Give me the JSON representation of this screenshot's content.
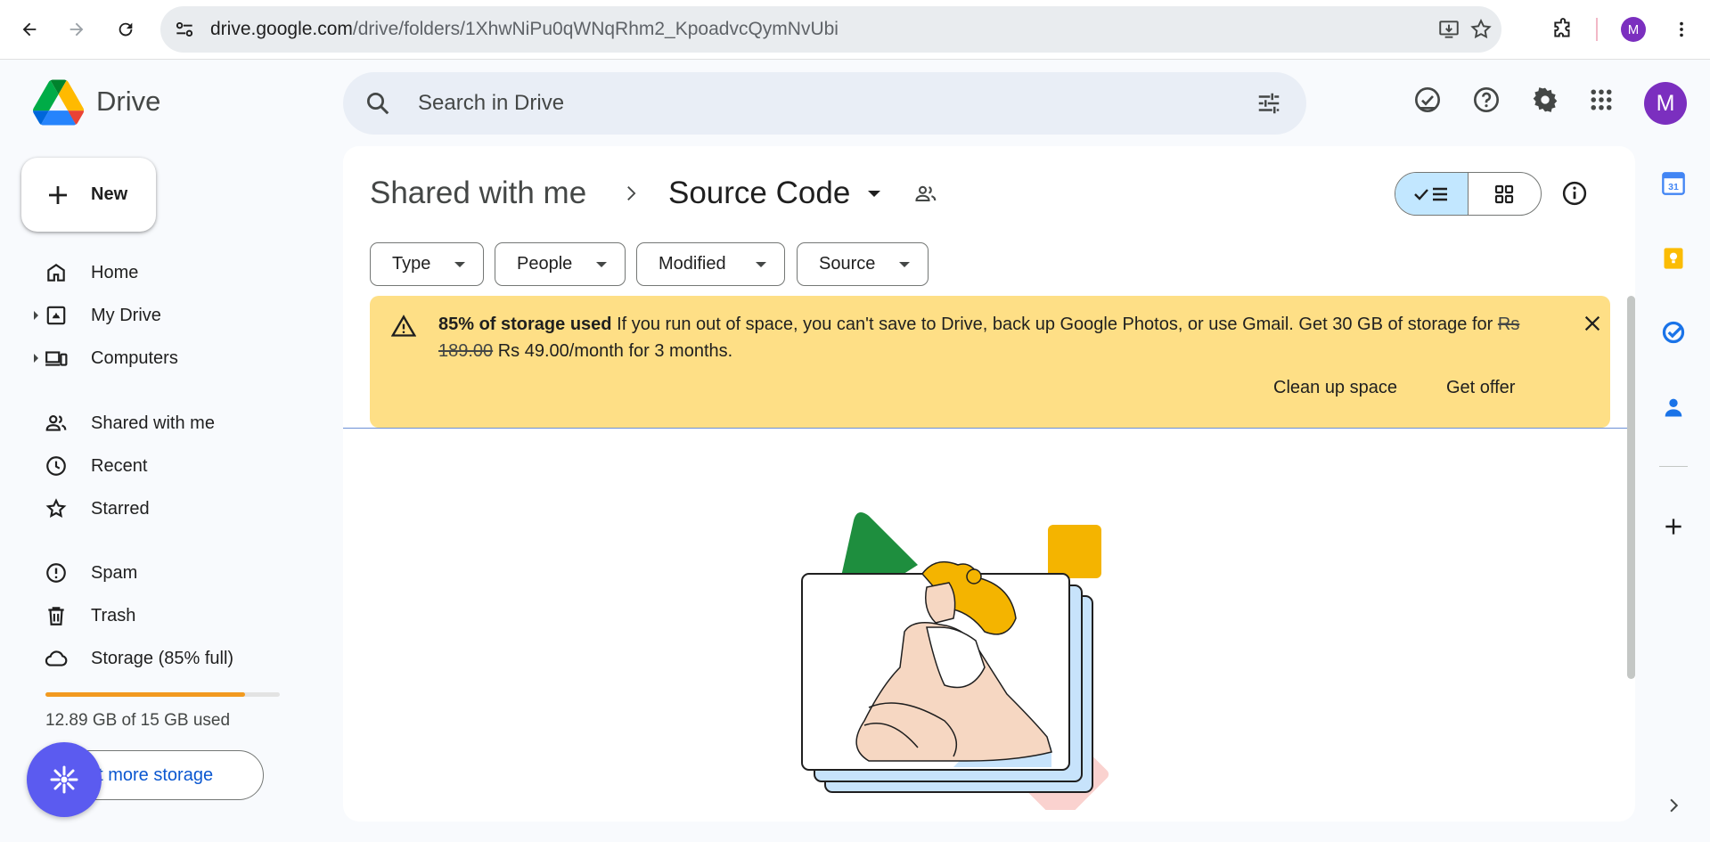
{
  "browser": {
    "url_host": "drive.google.com",
    "url_path": "/drive/folders/1XhwNiPu0qWNqRhm2_KpoadvcQymNvUbi",
    "profile_initial": "M"
  },
  "header": {
    "brand": "Drive",
    "search_placeholder": "Search in Drive",
    "avatar_initial": "M"
  },
  "sidebar": {
    "new_label": "New",
    "items": [
      {
        "label": "Home",
        "icon": "home-icon"
      },
      {
        "label": "My Drive",
        "icon": "my-drive-icon"
      },
      {
        "label": "Computers",
        "icon": "computers-icon"
      },
      {
        "label": "Shared with me",
        "icon": "shared-icon"
      },
      {
        "label": "Recent",
        "icon": "clock-icon"
      },
      {
        "label": "Starred",
        "icon": "star-icon"
      },
      {
        "label": "Spam",
        "icon": "spam-icon"
      },
      {
        "label": "Trash",
        "icon": "trash-icon"
      },
      {
        "label": "Storage (85% full)",
        "icon": "cloud-icon"
      }
    ],
    "storage_fraction": 0.85,
    "storage_text": "12.89 GB of 15 GB used",
    "get_storage_label": "et more storage"
  },
  "main": {
    "breadcrumb_root": "Shared with me",
    "breadcrumb_current": "Source Code",
    "filters": [
      "Type",
      "People",
      "Modified",
      "Source"
    ],
    "banner": {
      "title": "85% of storage used",
      "text": "If you run out of space, you can't save to Drive, back up Google Photos, or use Gmail. Get 30 GB of storage for",
      "old_price": "Rs 189.00",
      "new_price": "Rs 49.00/month for 3 months.",
      "action_cleanup": "Clean up space",
      "action_offer": "Get offer"
    }
  },
  "colors": {
    "accent": "#0b57d0",
    "banner_bg": "#fedf86",
    "storage_fill": "#f29a1f",
    "avatar": "#7b2fbf"
  }
}
